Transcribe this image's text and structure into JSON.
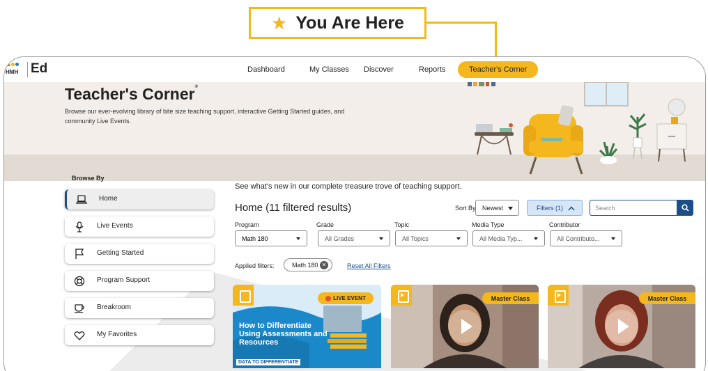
{
  "callout": {
    "text": "You Are Here",
    "icon": "star-icon",
    "color": "#f4b71d"
  },
  "app": {
    "brand_small": "HMH",
    "brand": "Ed"
  },
  "nav": {
    "items": [
      "Dashboard",
      "My Classes",
      "Discover",
      "Reports",
      "Teacher's Corner"
    ],
    "active": "Teacher's Corner"
  },
  "hero": {
    "title": "Teacher's Corner",
    "title_mark": "®",
    "description": "Browse our ever-evolving library of bite size teaching support, interactive Getting Started guides, and community Live Events."
  },
  "sidebar": {
    "heading": "Browse By",
    "items": [
      {
        "label": "Home",
        "icon": "laptop-icon",
        "active": true
      },
      {
        "label": "Live Events",
        "icon": "microphone-icon",
        "active": false
      },
      {
        "label": "Getting Started",
        "icon": "flag-icon",
        "active": false
      },
      {
        "label": "Program Support",
        "icon": "lifebuoy-icon",
        "active": false
      },
      {
        "label": "Breakroom",
        "icon": "coffee-cup-icon",
        "active": false
      },
      {
        "label": "My Favorites",
        "icon": "heart-icon",
        "active": false
      }
    ]
  },
  "main": {
    "intro": "See what's new in our complete treasure trove of teaching support.",
    "results_title": "Home (11 filtered results)",
    "sort_label": "Sort By",
    "sort_value": "Newest",
    "filters_button": "Filters (1)",
    "search_placeholder": "Search",
    "filters": [
      {
        "label": "Program",
        "value": "Math 180"
      },
      {
        "label": "Grade",
        "value": "All Grades"
      },
      {
        "label": "Topic",
        "value": "All Topics"
      },
      {
        "label": "Media Type",
        "value": "All Media Typ..."
      },
      {
        "label": "Contributor",
        "value": "All Contributo..."
      }
    ],
    "applied_label": "Applied filters:",
    "applied_chip": "Math 180",
    "reset_link": "Reset All Filters"
  },
  "cards": [
    {
      "badge": "LIVE EVENT",
      "title": "How to Differentiate Using Assessments and Resources",
      "tag": "DATA TO DIFFERENTIATE"
    },
    {
      "badge": "Master Class"
    },
    {
      "badge": "Master Class"
    }
  ],
  "colors": {
    "accent": "#f4b71d",
    "primary": "#1c4e8a",
    "hero_bg": "#f3eee9"
  }
}
